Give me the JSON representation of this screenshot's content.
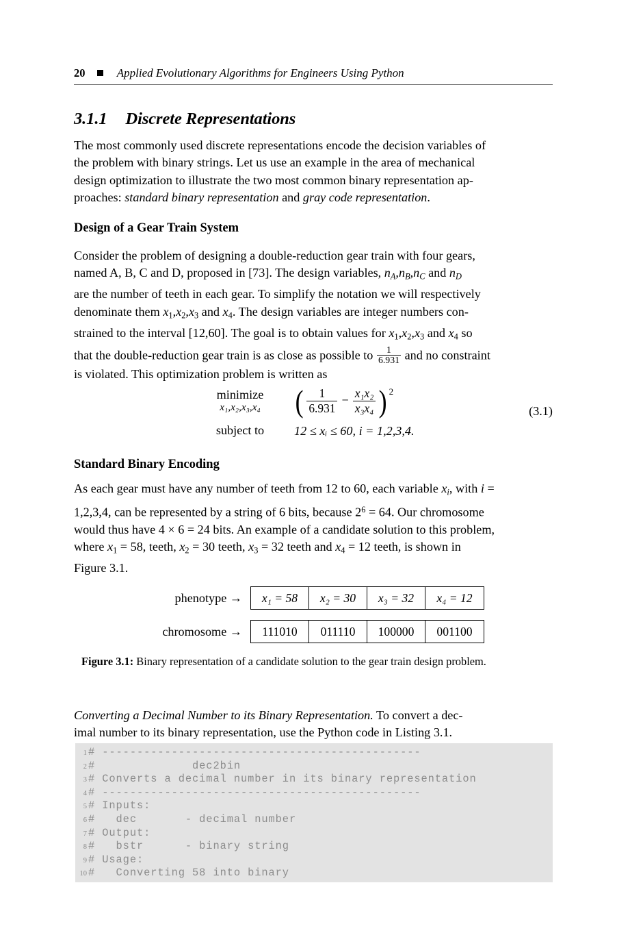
{
  "header": {
    "page_number": "20",
    "book_title": "Applied Evolutionary Algorithms for Engineers Using Python"
  },
  "section": {
    "number": "3.1.1",
    "title": "Discrete Representations"
  },
  "intro_paragraph": {
    "line1": "The most commonly used discrete representations encode the decision variables of",
    "line2": "the problem with binary strings. Let us use an example in the area of mechanical",
    "line3": "design optimization to illustrate the two most common binary representation ap-",
    "line4_a": "proaches: ",
    "line4_b": "standard binary representation",
    "line4_c": " and ",
    "line4_d": "gray code representation",
    "line4_e": "."
  },
  "gear_heading": "Design of a Gear Train System",
  "gear_paragraph": {
    "l1": "Consider the problem of designing a double-reduction gear train with four gears,",
    "l2_a": "named A, B, C and D, proposed in [73]. The design variables, ",
    "l2_n": "n",
    "l2_A": "A",
    "l2_B": "B",
    "l2_C": "C",
    "l2_and": " and ",
    "l2_D": "D",
    "l3": "are the number of teeth in each gear. To simplify the notation we will respectively",
    "l4_a": "denominate them ",
    "l4_b": ". The design variables are integer numbers con-",
    "l5_a": "strained to the interval [12,60]. The goal is to obtain values for ",
    "l5_b": " so",
    "l6_a": "that the double-reduction gear train is as close as possible to ",
    "l6_frac_num": "1",
    "l6_frac_den": "6.931",
    "l6_b": " and no constraint",
    "l7": "is violated. This optimization problem is written as"
  },
  "equation": {
    "minimize_label": "minimize",
    "minimize_vars": "x₁,x₂,x₃,x₄",
    "numerator_1": "1",
    "denominator_1": "6.931",
    "minus": "−",
    "numerator_2": "x₁x₂",
    "denominator_2": "x₃x₄",
    "exponent": "2",
    "subject_to_label": "subject to",
    "constraint": "12 ≤ xᵢ ≤ 60,   i = 1,2,3,4.",
    "number": "(3.1)"
  },
  "sbe_heading": "Standard Binary Encoding",
  "sbe_paragraph": {
    "l1_a": "As each gear must have any number of teeth from 12 to 60, each variable ",
    "l1_b": ", with  ",
    "l1_c": " =",
    "l2_a": "1,2,3,4, can be represented by a string of 6 bits, because 2",
    "l2_sup": "6",
    "l2_b": " = 64. Our chromosome",
    "l3": "would thus have 4 × 6 = 24 bits. An example of a candidate solution to this problem,",
    "l4_a": "where ",
    "l4_b": " = 58, teeth, ",
    "l4_c": " = 30 teeth, ",
    "l4_d": " = 32 teeth and ",
    "l4_e": " = 12 teeth, is shown in",
    "l5": "Figure 3.1."
  },
  "figure": {
    "phenotype_label": "phenotype →",
    "chromosome_label": "chromosome →",
    "phenotype_cells": [
      "x₁ = 58",
      "x₂ = 30",
      "x₃ = 32",
      "x₄ = 12"
    ],
    "chromosome_cells": [
      "111010",
      "011110",
      "100000",
      "001100"
    ],
    "caption_label": "Figure 3.1:",
    "caption_text": " Binary representation of a candidate solution to the gear train design problem."
  },
  "convert_paragraph": {
    "l1_italic": "Converting a Decimal Number to its Binary Representation.",
    "l1_rest": "  To convert a dec-",
    "l2": "imal number to its binary representation, use the Python code in Listing 3.1."
  },
  "listing": {
    "lines": [
      {
        "no": "1",
        "text": "# ----------------------------------------------"
      },
      {
        "no": "2",
        "text": "#              dec2bin"
      },
      {
        "no": "3",
        "text": "# Converts a decimal number in its binary representation"
      },
      {
        "no": "4",
        "text": "# ----------------------------------------------"
      },
      {
        "no": "5",
        "text": "# Inputs:"
      },
      {
        "no": "6",
        "text": "#   dec       - decimal number"
      },
      {
        "no": "7",
        "text": "# Output:"
      },
      {
        "no": "8",
        "text": "#   bstr      - binary string"
      },
      {
        "no": "9",
        "text": "# Usage:"
      },
      {
        "no": "10",
        "text": "#   Converting 58 into binary"
      }
    ]
  },
  "colors": {
    "code_background": "#e3e3e3",
    "code_text": "#8c8c8c",
    "rule": "#6f6f6f"
  }
}
